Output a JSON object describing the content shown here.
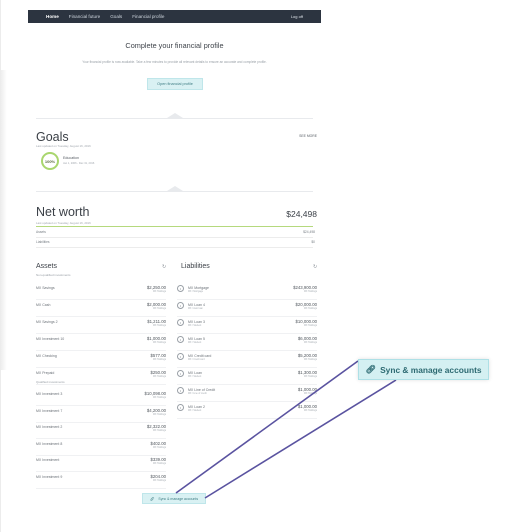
{
  "nav": {
    "items": [
      "Home",
      "Financial future",
      "Goals",
      "Financial profile"
    ],
    "logoff": "Log off"
  },
  "profile": {
    "title": "Complete your financial profile",
    "description": "Your financial profile is now available. Take a few minutes to provide all relevant details to ensure an accurate and complete profile.",
    "button": "Open financial profile"
  },
  "goals": {
    "title": "Goals",
    "updated": "Last updated on Tuesday, August 16, 2016",
    "see_more": "SEE MORE",
    "item": {
      "progress": "100%",
      "progress_value": 100,
      "name": "Education",
      "range": "Jan 1, 2006 - Dec 31, 2016"
    }
  },
  "networth": {
    "title": "Net worth",
    "updated": "Last updated on Tuesday, August 16, 2016",
    "value": "$24,498",
    "assets_label": "Assets",
    "assets_value": "$24,498",
    "liabilities_label": "Liabilities",
    "liabilities_value": "$0"
  },
  "assets": {
    "title": "Assets",
    "refresh_icon": "refresh-icon",
    "group_nonqualified": "Non-qualified investments",
    "group_qualified": "Qualified investments",
    "nonqualified": [
      {
        "name": "MX Savings",
        "balance": "$2,250.00",
        "sub": "MX Holdings"
      },
      {
        "name": "MX Cash",
        "balance": "$2,000.00",
        "sub": "MX Holdings"
      },
      {
        "name": "MX Savings 2",
        "balance": "$1,211.00",
        "sub": "MX Holdings"
      },
      {
        "name": "MX Investment 10",
        "balance": "$1,000.00",
        "sub": "MX Holdings"
      },
      {
        "name": "MX Checking",
        "balance": "$577.00",
        "sub": "MX Holdings"
      },
      {
        "name": "MX Prepaid",
        "balance": "$250.00",
        "sub": "MX Holdings"
      }
    ],
    "qualified": [
      {
        "name": "MX Investment 3",
        "balance": "$10,098.00",
        "sub": "MX Holdings"
      },
      {
        "name": "MX Investment 7",
        "balance": "$4,200.00",
        "sub": "MX Holdings"
      },
      {
        "name": "MX Investment 2",
        "balance": "$2,322.00",
        "sub": "MX Holdings"
      },
      {
        "name": "MX Investment 8",
        "balance": "$402.00",
        "sub": "MX Holdings"
      },
      {
        "name": "MX Investment",
        "balance": "$339.00",
        "sub": "MX Holdings"
      },
      {
        "name": "MX Investment 9",
        "balance": "$204.00",
        "sub": "MX Holdings"
      }
    ]
  },
  "liabilities": {
    "title": "Liabilities",
    "refresh_icon": "refresh-icon",
    "items": [
      {
        "name": "MX Mortgage",
        "lsub": "MX / Mortgage",
        "balance": "$243,900.00",
        "sub": "MX Holdings"
      },
      {
        "name": "MX Loan 4",
        "lsub": "MX / Auto loan",
        "balance": "$20,000.00",
        "sub": "MX Holdings"
      },
      {
        "name": "MX Loan 3",
        "lsub": "MX / Student",
        "balance": "$10,000.00",
        "sub": "MX Holdings"
      },
      {
        "name": "MX Loan 5",
        "lsub": "MX / Student",
        "balance": "$6,000.00",
        "sub": "MX Holdings"
      },
      {
        "name": "MX Credit card",
        "lsub": "MX / Credit card",
        "balance": "$5,200.00",
        "sub": "MX Holdings"
      },
      {
        "name": "MX Loan",
        "lsub": "MX / Student",
        "balance": "$1,300.00",
        "sub": "MX Holdings"
      },
      {
        "name": "MX Line of Credit",
        "lsub": "MX / Line of credit",
        "balance": "$1,000.00",
        "sub": "MX Holdings"
      },
      {
        "name": "MX Loan 2",
        "lsub": "MX / Student",
        "balance": "$1,000.00",
        "sub": "MX Holdings"
      }
    ]
  },
  "sync": {
    "label": "Sync & manage accounts",
    "icon": "link-icon"
  },
  "colors": {
    "nav_bg": "#2c3440",
    "button_bg": "#d9f1f3",
    "button_text": "#3f7d84",
    "goal_ring": "#a9d66e",
    "arrow": "#5a53a0"
  }
}
